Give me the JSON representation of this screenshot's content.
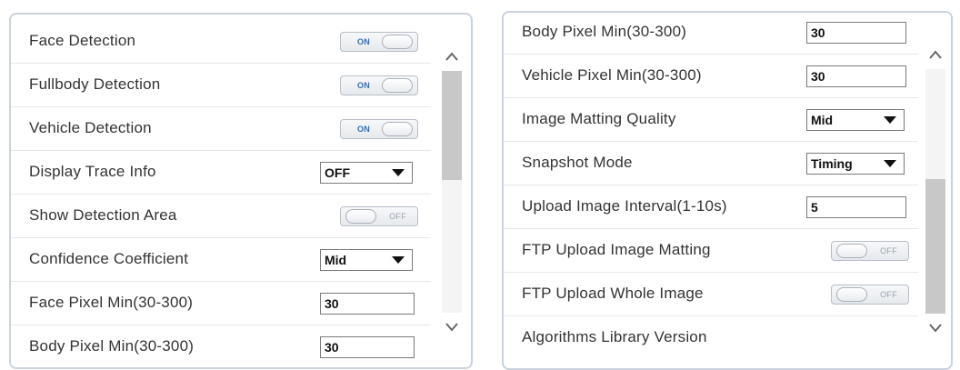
{
  "left_panel": {
    "rows": [
      {
        "label": "Face Detection",
        "type": "toggle",
        "state": "on",
        "toggle_text": "ON"
      },
      {
        "label": "Fullbody Detection",
        "type": "toggle",
        "state": "on",
        "toggle_text": "ON"
      },
      {
        "label": "Vehicle Detection",
        "type": "toggle",
        "state": "on",
        "toggle_text": "ON"
      },
      {
        "label": "Display Trace Info",
        "type": "select",
        "value": "OFF"
      },
      {
        "label": "Show Detection Area",
        "type": "toggle",
        "state": "off",
        "toggle_text": "OFF"
      },
      {
        "label": "Confidence Coefficient",
        "type": "select",
        "value": "Mid"
      },
      {
        "label": "Face Pixel Min(30-300)",
        "type": "input",
        "value": "30"
      },
      {
        "label": "Body Pixel Min(30-300)",
        "type": "input",
        "value": "30"
      }
    ],
    "scroll_position": 0.0,
    "scroll_visible_fraction": 0.45
  },
  "right_panel": {
    "rows": [
      {
        "label": "Body Pixel Min(30-300)",
        "type": "input",
        "value": "30"
      },
      {
        "label": "Vehicle Pixel Min(30-300)",
        "type": "input",
        "value": "30"
      },
      {
        "label": "Image Matting Quality",
        "type": "select",
        "value": "Mid"
      },
      {
        "label": "Snapshot Mode",
        "type": "select",
        "value": "Timing"
      },
      {
        "label": "Upload Image Interval(1-10s)",
        "type": "input",
        "value": "5"
      },
      {
        "label": "FTP Upload Image Matting",
        "type": "toggle",
        "state": "off",
        "toggle_text": "OFF"
      },
      {
        "label": "FTP Upload Whole Image",
        "type": "toggle",
        "state": "off",
        "toggle_text": "OFF"
      },
      {
        "label": "Algorithms Library Version",
        "type": "none"
      }
    ],
    "scroll_position": 1.0,
    "scroll_visible_fraction": 0.55
  },
  "icons": {
    "scroll_up": "chevron-up-icon",
    "scroll_down": "chevron-down-icon",
    "dropdown": "triangle-down-icon"
  },
  "colors": {
    "toggle_on_text": "#2a6fc4",
    "toggle_off_text": "#9aa2ab",
    "panel_border": "#c9d2dc",
    "scroll_thumb": "#c8c8c8"
  }
}
